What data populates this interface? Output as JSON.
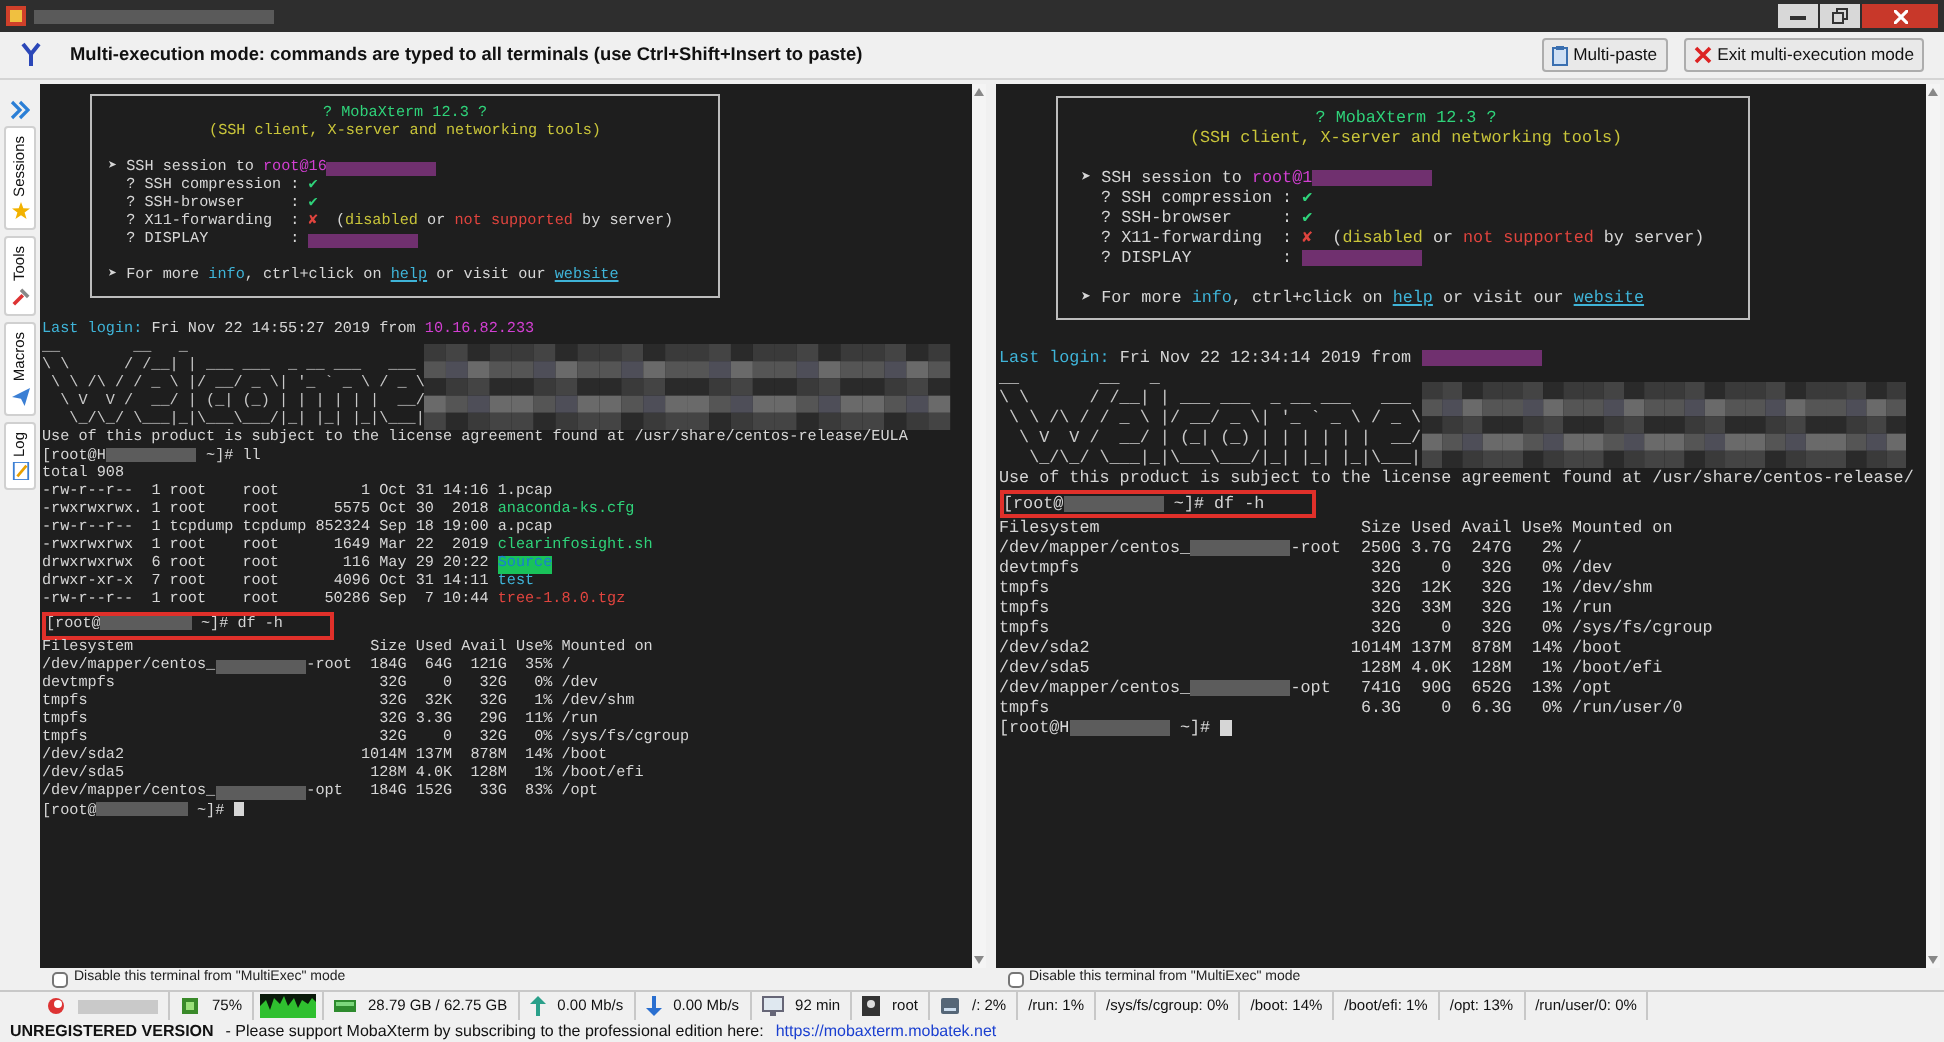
{
  "toolbar": {
    "message": "Multi-execution mode: commands are typed to all terminals (use Ctrl+Shift+Insert to paste)",
    "buttons": [
      {
        "label": "Multi-paste",
        "kind": "paste"
      },
      {
        "label": "Exit multi-execution mode",
        "kind": "exit"
      }
    ]
  },
  "sidebar": {
    "tabs": [
      {
        "label": "Sessions",
        "kind": "star"
      },
      {
        "label": "Tools",
        "kind": "tools"
      },
      {
        "label": "Macros",
        "kind": "macros"
      },
      {
        "label": "Log",
        "kind": "log"
      }
    ]
  },
  "terminals": [
    {
      "banner": {
        "title": "? MobaXterm 12.3 ?",
        "subtitle": "(SSH client, X-server and networking tools)",
        "details": [
          [
            {
              "text": "➤ SSH session to ",
              "kind": "plain"
            },
            {
              "text": "root@16",
              "kind": "magenta"
            },
            {
              "kind": "redacted_magenta"
            }
          ],
          [
            {
              "text": "  ? SSH compression : ",
              "kind": "plain"
            },
            {
              "text": "✔",
              "kind": "green"
            }
          ],
          [
            {
              "text": "  ? SSH-browser     : ",
              "kind": "plain"
            },
            {
              "text": "✔",
              "kind": "green"
            }
          ],
          [
            {
              "text": "  ? X11-forwarding  : ",
              "kind": "plain"
            },
            {
              "text": "✘",
              "kind": "red"
            },
            {
              "text": "  (",
              "kind": "plain"
            },
            {
              "text": "disabled",
              "kind": "yellow"
            },
            {
              "text": " or ",
              "kind": "plain"
            },
            {
              "text": "not supported",
              "kind": "red"
            },
            {
              "text": " by server)",
              "kind": "plain"
            }
          ],
          [
            {
              "text": "  ? DISPLAY         : ",
              "kind": "plain"
            },
            {
              "kind": "redacted_magenta"
            }
          ]
        ],
        "footer": [
          {
            "text": "➤ For more ",
            "kind": "plain"
          },
          {
            "text": "info",
            "kind": "cyan"
          },
          {
            "text": ", ctrl+click on ",
            "kind": "plain"
          },
          {
            "text": "help",
            "kind": "link"
          },
          {
            "text": " or visit our ",
            "kind": "plain"
          },
          {
            "text": "website",
            "kind": "link"
          }
        ]
      },
      "last_login": [
        {
          "text": "Last login:",
          "kind": "cyan"
        },
        {
          "text": " Fri Nov 22 14:55:27 2019 from ",
          "kind": "plain"
        },
        {
          "text": "10.16.82.233",
          "kind": "magenta"
        }
      ],
      "welcome_art": [
        "__        __   _",
        "\\ \\      / /__| | ___ ___  _ __ ___   ___",
        " \\ \\ /\\ / / _ \\ |/ __/ _ \\| '_ ` _ \\ / _ \\",
        "  \\ V  V /  __/ | (_| (_) | | | | | |  __/",
        "   \\_/\\_/ \\___|_|\\___\\___/|_| |_| |_|\\___|"
      ],
      "blocks": [
        {
          "kind": "line",
          "highlighted": false,
          "segments": [
            {
              "text": "Use of this product is subject to the license agreement found at /usr/share/centos-release/EULA",
              "kind": "plain"
            }
          ]
        },
        {
          "kind": "line",
          "highlighted": false,
          "segments": [
            {
              "text": "[root@H",
              "kind": "plain"
            },
            {
              "kind": "redacted"
            },
            {
              "text": " ~]# ll",
              "kind": "plain"
            }
          ]
        },
        {
          "kind": "line",
          "highlighted": false,
          "segments": [
            {
              "text": "total 908",
              "kind": "plain"
            }
          ]
        },
        {
          "kind": "listing",
          "rows": [
            {
              "perms": "-rw-r--r--",
              "links": "1",
              "owner": "root",
              "group": "root",
              "size": "1",
              "date": "Oct 31 14:16",
              "name": {
                "text": "1.pcap",
                "kind": "plain"
              }
            },
            {
              "perms": "-rwxrwxrwx.",
              "links": "1",
              "owner": "root",
              "group": "root",
              "size": "5575",
              "date": "Oct 30  2018",
              "name": {
                "text": "anaconda-ks.cfg",
                "kind": "green"
              }
            },
            {
              "perms": "-rw-r--r--",
              "links": "1",
              "owner": "tcpdump",
              "group": "tcpdump",
              "size": "852324",
              "date": "Sep 18 19:00",
              "name": {
                "text": "a.pcap",
                "kind": "plain"
              }
            },
            {
              "perms": "-rwxrwxrwx",
              "links": "1",
              "owner": "root",
              "group": "root",
              "size": "1649",
              "date": "Mar 22  2019",
              "name": {
                "text": "clearinfosight.sh",
                "kind": "green"
              }
            },
            {
              "perms": "drwxrwxrwx",
              "links": "6",
              "owner": "root",
              "group": "root",
              "size": "116",
              "date": "May 29 20:22",
              "name": {
                "text": "Source",
                "kind": "highlight"
              }
            },
            {
              "perms": "drwxr-xr-x",
              "links": "7",
              "owner": "root",
              "group": "root",
              "size": "4096",
              "date": "Oct 31 14:11",
              "name": {
                "text": "test",
                "kind": "cyan"
              }
            },
            {
              "perms": "-rw-r--r--",
              "links": "1",
              "owner": "root",
              "group": "root",
              "size": "50286",
              "date": "Sep  7 10:44",
              "name": {
                "text": "tree-1.8.0.tgz",
                "kind": "red"
              }
            }
          ]
        },
        {
          "kind": "line",
          "highlighted": true,
          "segments": [
            {
              "text": "[root@",
              "kind": "plain"
            },
            {
              "kind": "redacted"
            },
            {
              "text": " ~]# df -h",
              "kind": "plain"
            }
          ]
        },
        {
          "kind": "df",
          "columns": [
            "Filesystem",
            "Size",
            "Used",
            "Avail",
            "Use%",
            "Mounted on"
          ],
          "rows": [
            {
              "filesystem": [
                {
                  "text": "/dev/mapper/centos_",
                  "kind": "plain"
                },
                {
                  "kind": "redacted"
                },
                {
                  "text": "-root",
                  "kind": "plain"
                }
              ],
              "size": "184G",
              "used": "64G",
              "avail": "121G",
              "use": "35%",
              "mount": "/"
            },
            {
              "filesystem": [
                {
                  "text": "devtmpfs",
                  "kind": "plain"
                }
              ],
              "size": "32G",
              "used": "0",
              "avail": "32G",
              "use": "0%",
              "mount": "/dev"
            },
            {
              "filesystem": [
                {
                  "text": "tmpfs",
                  "kind": "plain"
                }
              ],
              "size": "32G",
              "used": "32K",
              "avail": "32G",
              "use": "1%",
              "mount": "/dev/shm"
            },
            {
              "filesystem": [
                {
                  "text": "tmpfs",
                  "kind": "plain"
                }
              ],
              "size": "32G",
              "used": "3.3G",
              "avail": "29G",
              "use": "11%",
              "mount": "/run"
            },
            {
              "filesystem": [
                {
                  "text": "tmpfs",
                  "kind": "plain"
                }
              ],
              "size": "32G",
              "used": "0",
              "avail": "32G",
              "use": "0%",
              "mount": "/sys/fs/cgroup"
            },
            {
              "filesystem": [
                {
                  "text": "/dev/sda2",
                  "kind": "plain"
                }
              ],
              "size": "1014M",
              "used": "137M",
              "avail": "878M",
              "use": "14%",
              "mount": "/boot"
            },
            {
              "filesystem": [
                {
                  "text": "/dev/sda5",
                  "kind": "plain"
                }
              ],
              "size": "128M",
              "used": "4.0K",
              "avail": "128M",
              "use": "1%",
              "mount": "/boot/efi"
            },
            {
              "filesystem": [
                {
                  "text": "/dev/mapper/centos_",
                  "kind": "plain"
                },
                {
                  "kind": "redacted"
                },
                {
                  "text": "-opt",
                  "kind": "plain"
                }
              ],
              "size": "184G",
              "used": "152G",
              "avail": "33G",
              "use": "83%",
              "mount": "/opt"
            }
          ]
        },
        {
          "kind": "line",
          "highlighted": false,
          "segments": [
            {
              "text": "[root@",
              "kind": "plain"
            },
            {
              "kind": "redacted"
            },
            {
              "text": " ~]# ",
              "kind": "plain"
            },
            {
              "kind": "cursor"
            }
          ]
        }
      ],
      "disable_checkbox": {
        "label": "Disable this terminal from \"MultiExec\" mode",
        "checked": false
      }
    },
    {
      "banner": {
        "title": "? MobaXterm 12.3 ?",
        "subtitle": "(SSH client, X-server and networking tools)",
        "details": [
          [
            {
              "text": "➤ SSH session to ",
              "kind": "plain"
            },
            {
              "text": "root@1",
              "kind": "magenta"
            },
            {
              "kind": "redacted_magenta"
            }
          ],
          [
            {
              "text": "  ? SSH compression : ",
              "kind": "plain"
            },
            {
              "text": "✔",
              "kind": "green"
            }
          ],
          [
            {
              "text": "  ? SSH-browser     : ",
              "kind": "plain"
            },
            {
              "text": "✔",
              "kind": "green"
            }
          ],
          [
            {
              "text": "  ? X11-forwarding  : ",
              "kind": "plain"
            },
            {
              "text": "✘",
              "kind": "red"
            },
            {
              "text": "  (",
              "kind": "plain"
            },
            {
              "text": "disabled",
              "kind": "yellow"
            },
            {
              "text": " or ",
              "kind": "plain"
            },
            {
              "text": "not supported",
              "kind": "red"
            },
            {
              "text": " by server)",
              "kind": "plain"
            }
          ],
          [
            {
              "text": "  ? DISPLAY         : ",
              "kind": "plain"
            },
            {
              "kind": "redacted_magenta"
            }
          ]
        ],
        "footer": [
          {
            "text": "➤ For more ",
            "kind": "plain"
          },
          {
            "text": "info",
            "kind": "cyan"
          },
          {
            "text": ", ctrl+click on ",
            "kind": "plain"
          },
          {
            "text": "help",
            "kind": "link"
          },
          {
            "text": " or visit our ",
            "kind": "plain"
          },
          {
            "text": "website",
            "kind": "link"
          }
        ]
      },
      "last_login": [
        {
          "text": "Last login:",
          "kind": "cyan"
        },
        {
          "text": " Fri Nov 22 12:34:14 2019 from ",
          "kind": "plain"
        },
        {
          "kind": "redacted_magenta"
        }
      ],
      "welcome_art": [
        "__        __   _",
        "\\ \\      / /__| | ___ ___  _ __ ___   ___",
        " \\ \\ /\\ / / _ \\ |/ __/ _ \\| '_ ` _ \\ / _ \\",
        "  \\ V  V /  __/ | (_| (_) | | | | | |  __/",
        "   \\_/\\_/ \\___|_|\\___\\___/|_| |_| |_|\\___|"
      ],
      "blocks": [
        {
          "kind": "line",
          "highlighted": false,
          "segments": [
            {
              "text": "Use of this product is subject to the license agreement found at /usr/share/centos-release/",
              "kind": "plain"
            }
          ]
        },
        {
          "kind": "line",
          "highlighted": true,
          "segments": [
            {
              "text": "[root@",
              "kind": "plain"
            },
            {
              "kind": "redacted"
            },
            {
              "text": " ~]# df -h",
              "kind": "plain"
            }
          ]
        },
        {
          "kind": "df",
          "columns": [
            "Filesystem",
            "Size",
            "Used",
            "Avail",
            "Use%",
            "Mounted on"
          ],
          "rows": [
            {
              "filesystem": [
                {
                  "text": "/dev/mapper/centos_",
                  "kind": "plain"
                },
                {
                  "kind": "redacted"
                },
                {
                  "text": "-root",
                  "kind": "plain"
                }
              ],
              "size": "250G",
              "used": "3.7G",
              "avail": "247G",
              "use": "2%",
              "mount": "/"
            },
            {
              "filesystem": [
                {
                  "text": "devtmpfs",
                  "kind": "plain"
                }
              ],
              "size": "32G",
              "used": "0",
              "avail": "32G",
              "use": "0%",
              "mount": "/dev"
            },
            {
              "filesystem": [
                {
                  "text": "tmpfs",
                  "kind": "plain"
                }
              ],
              "size": "32G",
              "used": "12K",
              "avail": "32G",
              "use": "1%",
              "mount": "/dev/shm"
            },
            {
              "filesystem": [
                {
                  "text": "tmpfs",
                  "kind": "plain"
                }
              ],
              "size": "32G",
              "used": "33M",
              "avail": "32G",
              "use": "1%",
              "mount": "/run"
            },
            {
              "filesystem": [
                {
                  "text": "tmpfs",
                  "kind": "plain"
                }
              ],
              "size": "32G",
              "used": "0",
              "avail": "32G",
              "use": "0%",
              "mount": "/sys/fs/cgroup"
            },
            {
              "filesystem": [
                {
                  "text": "/dev/sda2",
                  "kind": "plain"
                }
              ],
              "size": "1014M",
              "used": "137M",
              "avail": "878M",
              "use": "14%",
              "mount": "/boot"
            },
            {
              "filesystem": [
                {
                  "text": "/dev/sda5",
                  "kind": "plain"
                }
              ],
              "size": "128M",
              "used": "4.0K",
              "avail": "128M",
              "use": "1%",
              "mount": "/boot/efi"
            },
            {
              "filesystem": [
                {
                  "text": "/dev/mapper/centos_",
                  "kind": "plain"
                },
                {
                  "kind": "redacted"
                },
                {
                  "text": "-opt",
                  "kind": "plain"
                }
              ],
              "size": "741G",
              "used": "90G",
              "avail": "652G",
              "use": "13%",
              "mount": "/opt"
            },
            {
              "filesystem": [
                {
                  "text": "tmpfs",
                  "kind": "plain"
                }
              ],
              "size": "6.3G",
              "used": "0",
              "avail": "6.3G",
              "use": "0%",
              "mount": "/run/user/0"
            }
          ]
        },
        {
          "kind": "line",
          "highlighted": false,
          "segments": [
            {
              "text": "[root@H",
              "kind": "plain"
            },
            {
              "kind": "redacted"
            },
            {
              "text": " ~]# ",
              "kind": "plain"
            },
            {
              "kind": "cursor"
            }
          ]
        }
      ],
      "disable_checkbox": {
        "label": "Disable this terminal from \"MultiExec\" mode",
        "checked": false
      }
    }
  ],
  "status_bar": [
    {
      "kind": "host"
    },
    {
      "kind": "cpu",
      "text": "75%"
    },
    {
      "kind": "graph"
    },
    {
      "kind": "memory",
      "text": "28.79 GB / 62.75 GB"
    },
    {
      "kind": "upload",
      "text": "0.00 Mb/s"
    },
    {
      "kind": "download",
      "text": "0.00 Mb/s"
    },
    {
      "kind": "uptime",
      "text": "92 min"
    },
    {
      "kind": "user",
      "text": "root"
    },
    {
      "kind": "disk_main",
      "text": "/: 2%"
    },
    {
      "kind": "disk",
      "text": "/run: 1%"
    },
    {
      "kind": "disk",
      "text": "/sys/fs/cgroup: 0%"
    },
    {
      "kind": "disk",
      "text": "/boot: 14%"
    },
    {
      "kind": "disk",
      "text": "/boot/efi: 1%"
    },
    {
      "kind": "disk",
      "text": "/opt: 13%"
    },
    {
      "kind": "disk",
      "text": "/run/user/0: 0%"
    }
  ],
  "footer": {
    "badge": "UNREGISTERED VERSION",
    "message": "-  Please support MobaXterm by subscribing to the professional edition here:",
    "link": "https://mobaxterm.mobatek.net"
  }
}
